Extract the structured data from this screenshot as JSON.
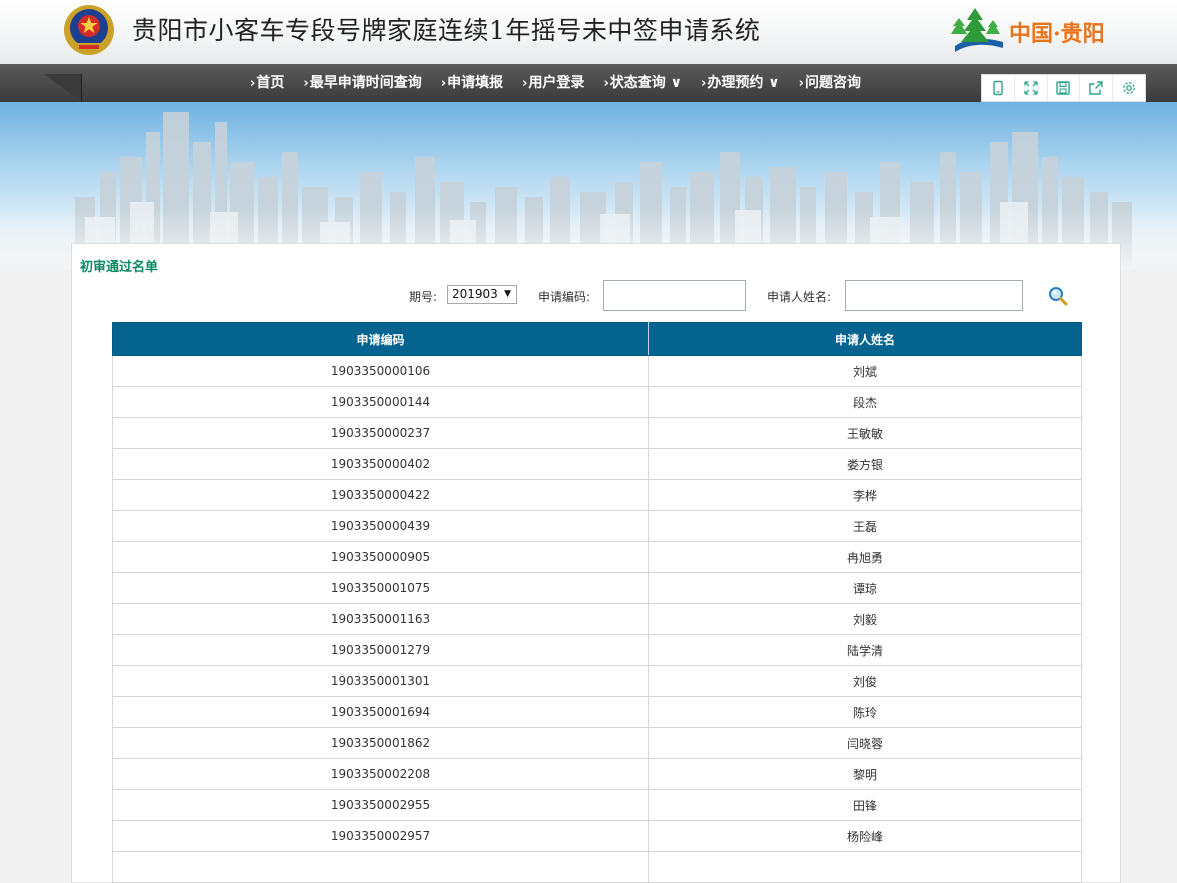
{
  "header": {
    "title": "贵阳市小客车专段号牌家庭连续1年摇号未中签申请系统",
    "logo_text": "中国·贵阳"
  },
  "nav": {
    "items": [
      {
        "label": "首页",
        "dropdown": false
      },
      {
        "label": "最早申请时间查询",
        "dropdown": false
      },
      {
        "label": "申请填报",
        "dropdown": false
      },
      {
        "label": "用户登录",
        "dropdown": false
      },
      {
        "label": "状态查询 ∨",
        "dropdown": true
      },
      {
        "label": "办理预约 ∨",
        "dropdown": true
      },
      {
        "label": "问题咨询",
        "dropdown": false
      }
    ],
    "chevron": "›"
  },
  "toolbar": {
    "icons": [
      "mobile-icon",
      "fullscreen-icon",
      "save-icon",
      "share-icon",
      "gear-icon"
    ],
    "color": "#2aa58a"
  },
  "panel": {
    "title": "初审通过名单"
  },
  "filters": {
    "period_label": "期号:",
    "period_value": "201903",
    "code_label": "申请编码:",
    "code_value": "",
    "name_label": "申请人姓名:",
    "name_value": ""
  },
  "table": {
    "headers": [
      "申请编码",
      "申请人姓名"
    ],
    "rows": [
      [
        "1903350000106",
        "刘斌"
      ],
      [
        "1903350000144",
        "段杰"
      ],
      [
        "1903350000237",
        "王敏敏"
      ],
      [
        "1903350000402",
        "娄方银"
      ],
      [
        "1903350000422",
        "李桦"
      ],
      [
        "1903350000439",
        "王磊"
      ],
      [
        "1903350000905",
        "冉旭勇"
      ],
      [
        "1903350001075",
        "谭琼"
      ],
      [
        "1903350001163",
        "刘毅"
      ],
      [
        "1903350001279",
        "陆学清"
      ],
      [
        "1903350001301",
        "刘俊"
      ],
      [
        "1903350001694",
        "陈玲"
      ],
      [
        "1903350001862",
        "闫晓蓉"
      ],
      [
        "1903350002208",
        "黎明"
      ],
      [
        "1903350002955",
        "田锋"
      ],
      [
        "1903350002957",
        "杨险峰"
      ],
      [
        "",
        ""
      ]
    ]
  },
  "colors": {
    "header_blue": "#05648f",
    "title_green": "#0a8a63",
    "logo_orange": "#e8741c"
  }
}
